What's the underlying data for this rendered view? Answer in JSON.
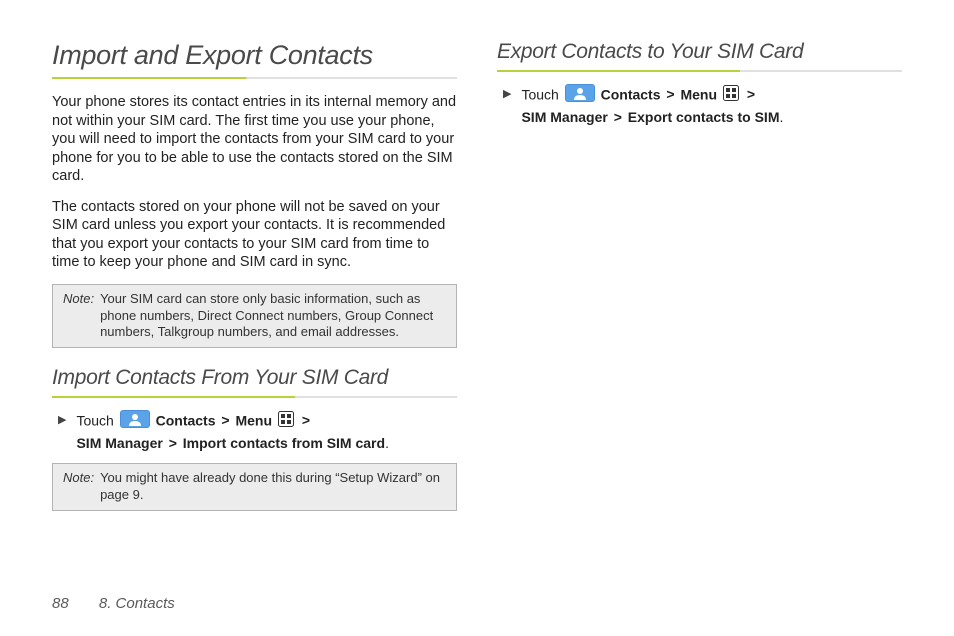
{
  "left": {
    "h1": "Import and Export Contacts",
    "p1": "Your phone stores its contact entries in its internal memory and not within your SIM card. The first time you use your phone, you will need to import the contacts from your SIM card to your phone for you to be able to use the contacts stored on the SIM card.",
    "p2": "The contacts stored on your phone will not be saved on your SIM card unless you export your contacts. It is recommended that you export your contacts to your SIM card from time to time to keep your phone and SIM card in sync.",
    "note1_label": "Note:",
    "note1_text": "Your SIM card can store only basic information, such as phone numbers, Direct Connect numbers, Group Connect numbers, Talkgroup numbers, and email addresses.",
    "h2": "Import Contacts From Your SIM Card",
    "step_touch": "Touch",
    "step_contacts": "Contacts",
    "step_menu": "Menu",
    "step_sim_mgr": "SIM Manager",
    "step_import": "Import contacts from SIM card",
    "step_period": ".",
    "note2_label": "Note:",
    "note2_text": "You might have already done this during “Setup Wizard” on page 9."
  },
  "right": {
    "h2": "Export Contacts to Your SIM Card",
    "step_touch": "Touch",
    "step_contacts": "Contacts",
    "step_menu": "Menu",
    "step_sim_mgr": "SIM Manager",
    "step_export": "Export contacts to SIM",
    "step_period": "."
  },
  "gt": ">",
  "footer": {
    "page": "88",
    "section": "8. Contacts"
  }
}
